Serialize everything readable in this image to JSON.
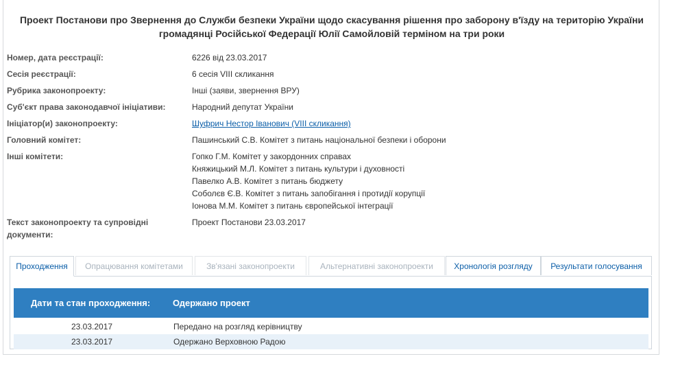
{
  "title": {
    "line1": "Проект Постанови про Звернення до Служби безпеки України щодо скасування рішення про заборону в'їзду на територію України",
    "line2": "громадянці Російської Федерації Юлії Самойловій терміном на три роки"
  },
  "info": {
    "reg_label": "Номер, дата реєстрації:",
    "reg_value": "6226 від 23.03.2017",
    "session_label": "Сесія реєстрації:",
    "session_value": "6 сесія VIII скликання",
    "rubric_label": "Рубрика законопроекту:",
    "rubric_value": "Інші (заяви, звернення ВРУ)",
    "subject_label": "Суб'єкт права законодавчої ініціативи:",
    "subject_value": "Народний депутат України",
    "initiator_label": "Ініціатор(и) законопроекту:",
    "initiator_value": "Шуфрич Нестор Іванович (VIII скликання)",
    "main_committee_label": "Головний комітет:",
    "main_committee_value": "Пашинський С.В. Комітет з питань національної безпеки і оборони",
    "other_committees_label": "Інші комітети:",
    "other_committees": [
      "Гопко Г.М. Комітет у закордонних справах",
      "Княжицький М.Л. Комітет з питань культури і духовності",
      "Павелко А.В. Комітет з питань бюджету",
      "Соболєв Є.В. Комітет з питань запобігання і протидії корупції",
      "Іонова М.М. Комітет з питань європейської інтеграції"
    ],
    "docs_label_1": "Текст законопроекту та супровідні",
    "docs_label_2": "документи:",
    "docs_value": "Проект Постанови 23.03.2017"
  },
  "tabs": [
    {
      "label": "Проходження"
    },
    {
      "label": "Опрацювання комітетами"
    },
    {
      "label": "Зв'язані законопроекти"
    },
    {
      "label": "Альтернативні законопроекти"
    },
    {
      "label": "Хронологія розгляду"
    },
    {
      "label": "Результати голосування"
    }
  ],
  "table": {
    "col1": "Дати та стан проходження:",
    "col2": "Одержано проект",
    "rows": [
      {
        "date": "23.03.2017",
        "text": "Передано на розгляд керівництву"
      },
      {
        "date": "23.03.2017",
        "text": "Одержано Верховною Радою"
      }
    ]
  }
}
